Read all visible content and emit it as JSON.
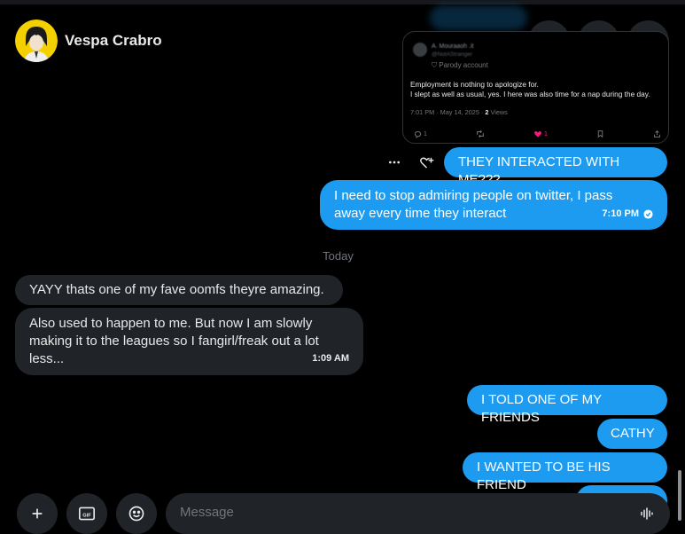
{
  "header": {
    "name": "Vespa Crabro"
  },
  "icons": {
    "call": "phone-icon",
    "video": "video-icon",
    "more": "more-icon"
  },
  "tweet": {
    "author_blur": "A. Mouraaoh .it",
    "handle_blur": "@NotAStranger",
    "parody_label": "Parody account",
    "line1": "Employment is nothing to apologize for.",
    "line2": "I slept as well as usual, yes. I here was also time for a nap during the day.",
    "meta_time": "7:01 PM · May 14, 2025 · ",
    "meta_views_num": "2",
    "meta_views_label": " Views",
    "replies": "1",
    "likes": "1"
  },
  "messages": {
    "m1": "THEY INTERACTED WITH ME???",
    "m2": "I need to stop admiring people on twitter, I pass away every time they interact",
    "m2_time": "7:10 PM",
    "divider": "Today",
    "r1": "YAYY thats one of my fave oomfs theyre amazing.",
    "r2": "Also used to happen to me. But now I am slowly making it to the leagues so I fangirl/freak out a lot less...",
    "r2_time": "1:09 AM",
    "m3": "I TOLD ONE OF MY FRIENDS",
    "m4": "CATHY",
    "m5": "I WANTED TO BE HIS FRIEND"
  },
  "composer": {
    "placeholder": "Message",
    "gif_label": "GIF"
  },
  "colors": {
    "accent": "#1d9bf0",
    "bubble_other": "#202327",
    "background": "#000000",
    "like": "#f91880"
  }
}
